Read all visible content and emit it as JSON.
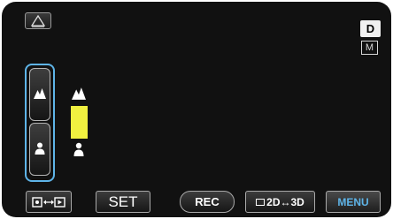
{
  "top_left_button": {
    "icon": "warning-triangle-icon"
  },
  "status": {
    "mode_badge": "D",
    "manual_badge": "M"
  },
  "focus_control": {
    "far_button_icon": "mountain-icon",
    "near_button_icon": "person-icon",
    "focus_level": 0.45,
    "indicator_color": "#f0f040",
    "accent_color": "#5eb4e8"
  },
  "bottom_bar": {
    "display_icon": "display-toggle-icon",
    "set_label": "SET",
    "rec_label": "REC",
    "mode_2d3d_label": "2D↔3D",
    "menu_label": "MENU"
  }
}
